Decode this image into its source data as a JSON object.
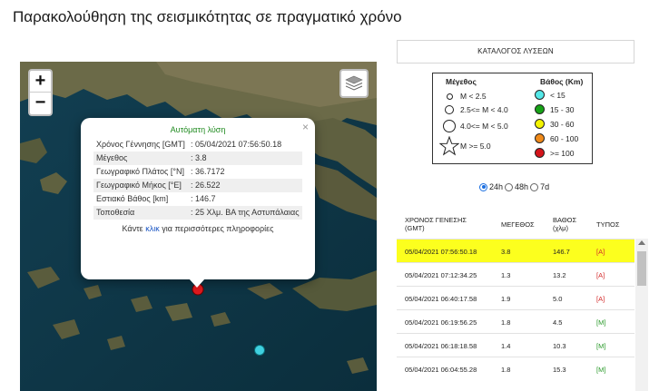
{
  "page": {
    "title": "Παρακολούθηση της σεισμικότητας σε πραγματικό χρόνο"
  },
  "map": {
    "zoom_in_label": "+",
    "zoom_out_label": "−",
    "layers_icon": "layers-icon",
    "popup": {
      "title": "Αυτόματη λύση",
      "close_label": "×",
      "fields": [
        {
          "key": "Χρόνος Γέννησης [GMT]",
          "value": ": 05/04/2021 07:56:50.18"
        },
        {
          "key": "Μέγεθος",
          "value": ": 3.8"
        },
        {
          "key": "Γεωγραφικό Πλάτος [°N]",
          "value": ": 36.7172"
        },
        {
          "key": "Γεωγραφικό Μήκος [°E]",
          "value": ": 26.522"
        },
        {
          "key": "Εστιακό Βάθος [km]",
          "value": ": 146.7"
        },
        {
          "key": "Τοποθεσία",
          "value": ": 25 Χλμ. ΒΑ της Αστυπάλαιας"
        }
      ],
      "more_prefix": "Κάντε",
      "more_link": "κλικ",
      "more_suffix": "για περισσότερες πληροφορίες"
    },
    "markers": [
      {
        "name": "selected-event-marker",
        "color": "#e0191e"
      },
      {
        "name": "event-marker-cyan",
        "color": "#3fd0e0"
      }
    ]
  },
  "panel": {
    "header": "ΚΑΤΑΛΟΓΟΣ ΛΥΣΕΩΝ",
    "legend": {
      "magnitude_title": "Μέγεθος",
      "depth_title": "Βάθος (Km)",
      "magnitudes": [
        "M < 2.5",
        "2.5<= M < 4.0",
        "4.0<= M < 5.0",
        "M >= 5.0"
      ],
      "depths": [
        {
          "label": "< 15",
          "color": "#55e8e8"
        },
        {
          "label": "15 - 30",
          "color": "#17a317"
        },
        {
          "label": "30 - 60",
          "color": "#f4f400"
        },
        {
          "label": "60 - 100",
          "color": "#f08a1a"
        },
        {
          "label": ">= 100",
          "color": "#d4141b"
        }
      ]
    },
    "period": {
      "options": [
        "24h",
        "48h",
        "7d"
      ],
      "selected": "24h"
    },
    "table": {
      "columns": [
        "ΧΡΟΝΟΣ ΓΕΝΕΣΗΣ (GMT)",
        "ΜΕΓΕΘΟΣ",
        "ΒΑΘΟΣ (χλμ)",
        "ΤΥΠΟΣ"
      ],
      "rows": [
        {
          "time": "05/04/2021 07:56:50.18",
          "mag": "3.8",
          "depth": "146.7",
          "type": "[A]",
          "selected": true
        },
        {
          "time": "05/04/2021 07:12:34.25",
          "mag": "1.3",
          "depth": "13.2",
          "type": "[A]"
        },
        {
          "time": "05/04/2021 06:40:17.58",
          "mag": "1.9",
          "depth": "5.0",
          "type": "[A]"
        },
        {
          "time": "05/04/2021 06:19:56.25",
          "mag": "1.8",
          "depth": "4.5",
          "type": "[M]"
        },
        {
          "time": "05/04/2021 06:18:18.58",
          "mag": "1.4",
          "depth": "10.3",
          "type": "[M]"
        },
        {
          "time": "05/04/2021 06:04:55.28",
          "mag": "1.8",
          "depth": "15.3",
          "type": "[M]"
        }
      ]
    }
  }
}
